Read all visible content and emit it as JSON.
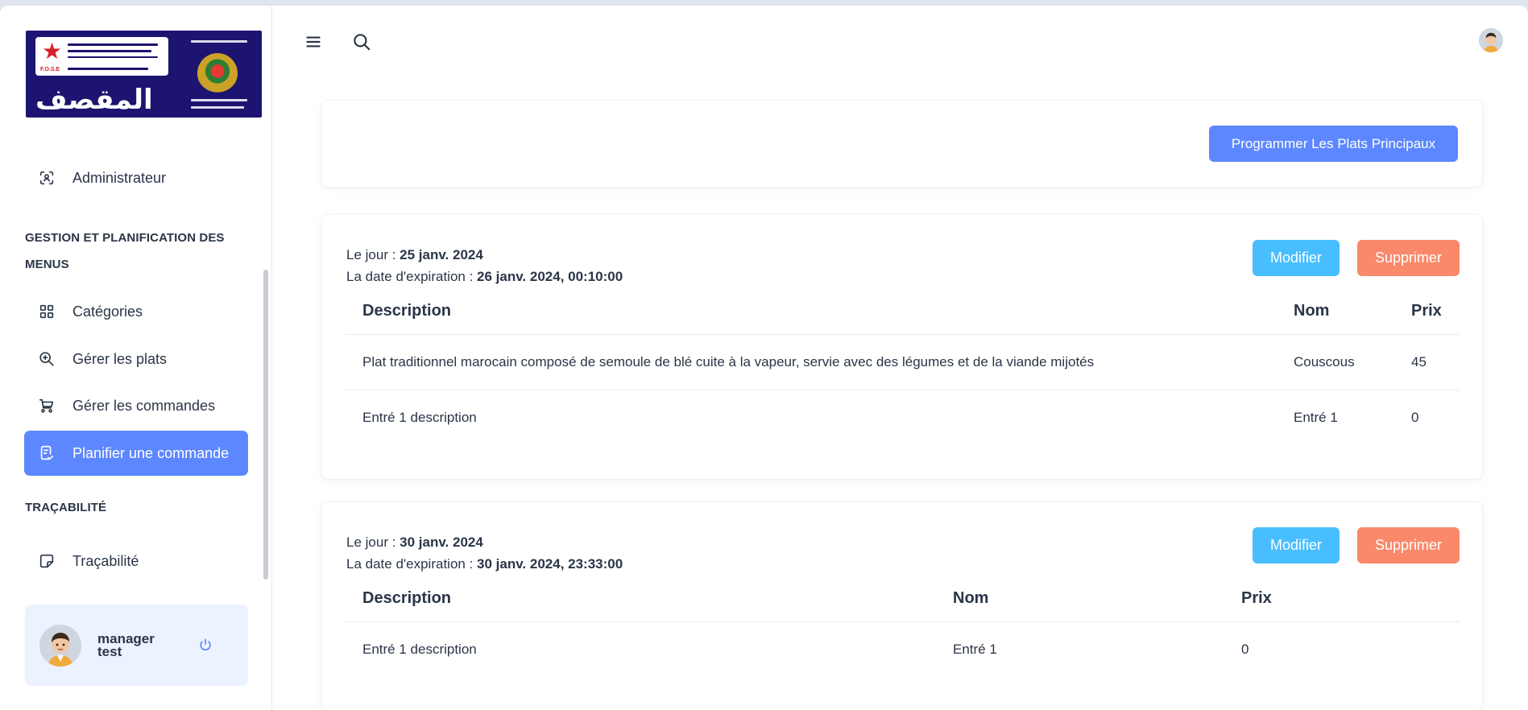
{
  "colors": {
    "primary": "#5d87ff",
    "info": "#49beff",
    "danger": "#fa896b",
    "logo_bg": "#1c1470",
    "profile_bg": "#ecf2ff"
  },
  "logo": {
    "arabic_wordmark": "المقصف",
    "org_name": "Fondation des Œuvres Sociales de l'Enseignement",
    "abbr": "F.O.S.E",
    "icon": "royal-emblem-icon"
  },
  "sidebar": {
    "admin_item": {
      "label": "Administrateur",
      "icon": "admin-scan-icon"
    },
    "section_gestion": "GESTION ET PLANIFICATION DES MENUS",
    "items": [
      {
        "label": "Catégories",
        "icon": "grid-icon"
      },
      {
        "label": "Gérer les plats",
        "icon": "zoom-icon"
      },
      {
        "label": "Gérer les commandes",
        "icon": "cart-icon"
      },
      {
        "label": "Planifier une commande",
        "icon": "clipboard-check-icon",
        "active": true
      }
    ],
    "section_trace": "TRAÇABILITÉ",
    "trace_item": {
      "label": "Traçabilité",
      "icon": "sticky-note-icon"
    },
    "profile": {
      "name": "manager test",
      "logout_icon": "power-icon"
    }
  },
  "topbar": {
    "menu_icon": "hamburger-icon",
    "search_icon": "search-icon",
    "avatar_icon": "user-avatar-icon"
  },
  "main": {
    "program_button": "Programmer Les Plats Principaux",
    "day_label": "Le jour :",
    "expiry_label": "La date d'expiration :",
    "edit_label": "Modifier",
    "delete_label": "Supprimer",
    "orders": [
      {
        "day": "25 janv. 2024",
        "expiry": "26 janv. 2024, 00:10:00",
        "headers": [
          "Description",
          "Nom",
          "Prix"
        ],
        "rows": [
          [
            "Plat traditionnel marocain composé de semoule de blé cuite à la vapeur, servie avec des légumes et de la viande mijotés",
            "Couscous",
            "45"
          ],
          [
            "Entré 1 description",
            "Entré 1",
            "0"
          ]
        ]
      },
      {
        "day": "30 janv. 2024",
        "expiry": "30 janv. 2024, 23:33:00",
        "headers": [
          "Description",
          "Nom",
          "Prix"
        ],
        "rows": [
          [
            "Entré 1 description",
            "Entré 1",
            "0"
          ]
        ]
      }
    ]
  }
}
